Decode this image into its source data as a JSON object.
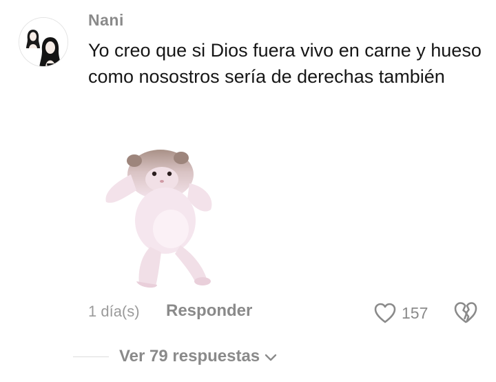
{
  "comment": {
    "username": "Nani",
    "text": "Yo creo que si Dios fuera vivo en carne y hueso como nosostros sería de derechas también",
    "sticker_icon": "dancing-hamster-sticker",
    "timestamp": "1 día(s)",
    "reply_label": "Responder",
    "like_count": "157",
    "like_icon": "heart-outline-icon",
    "dislike_icon": "broken-heart-icon"
  },
  "replies": {
    "view_label": "Ver 79 respuestas",
    "chevron_icon": "chevron-down-icon"
  },
  "colors": {
    "text": "#161616",
    "muted": "#8a8a8a",
    "background": "#ffffff"
  }
}
